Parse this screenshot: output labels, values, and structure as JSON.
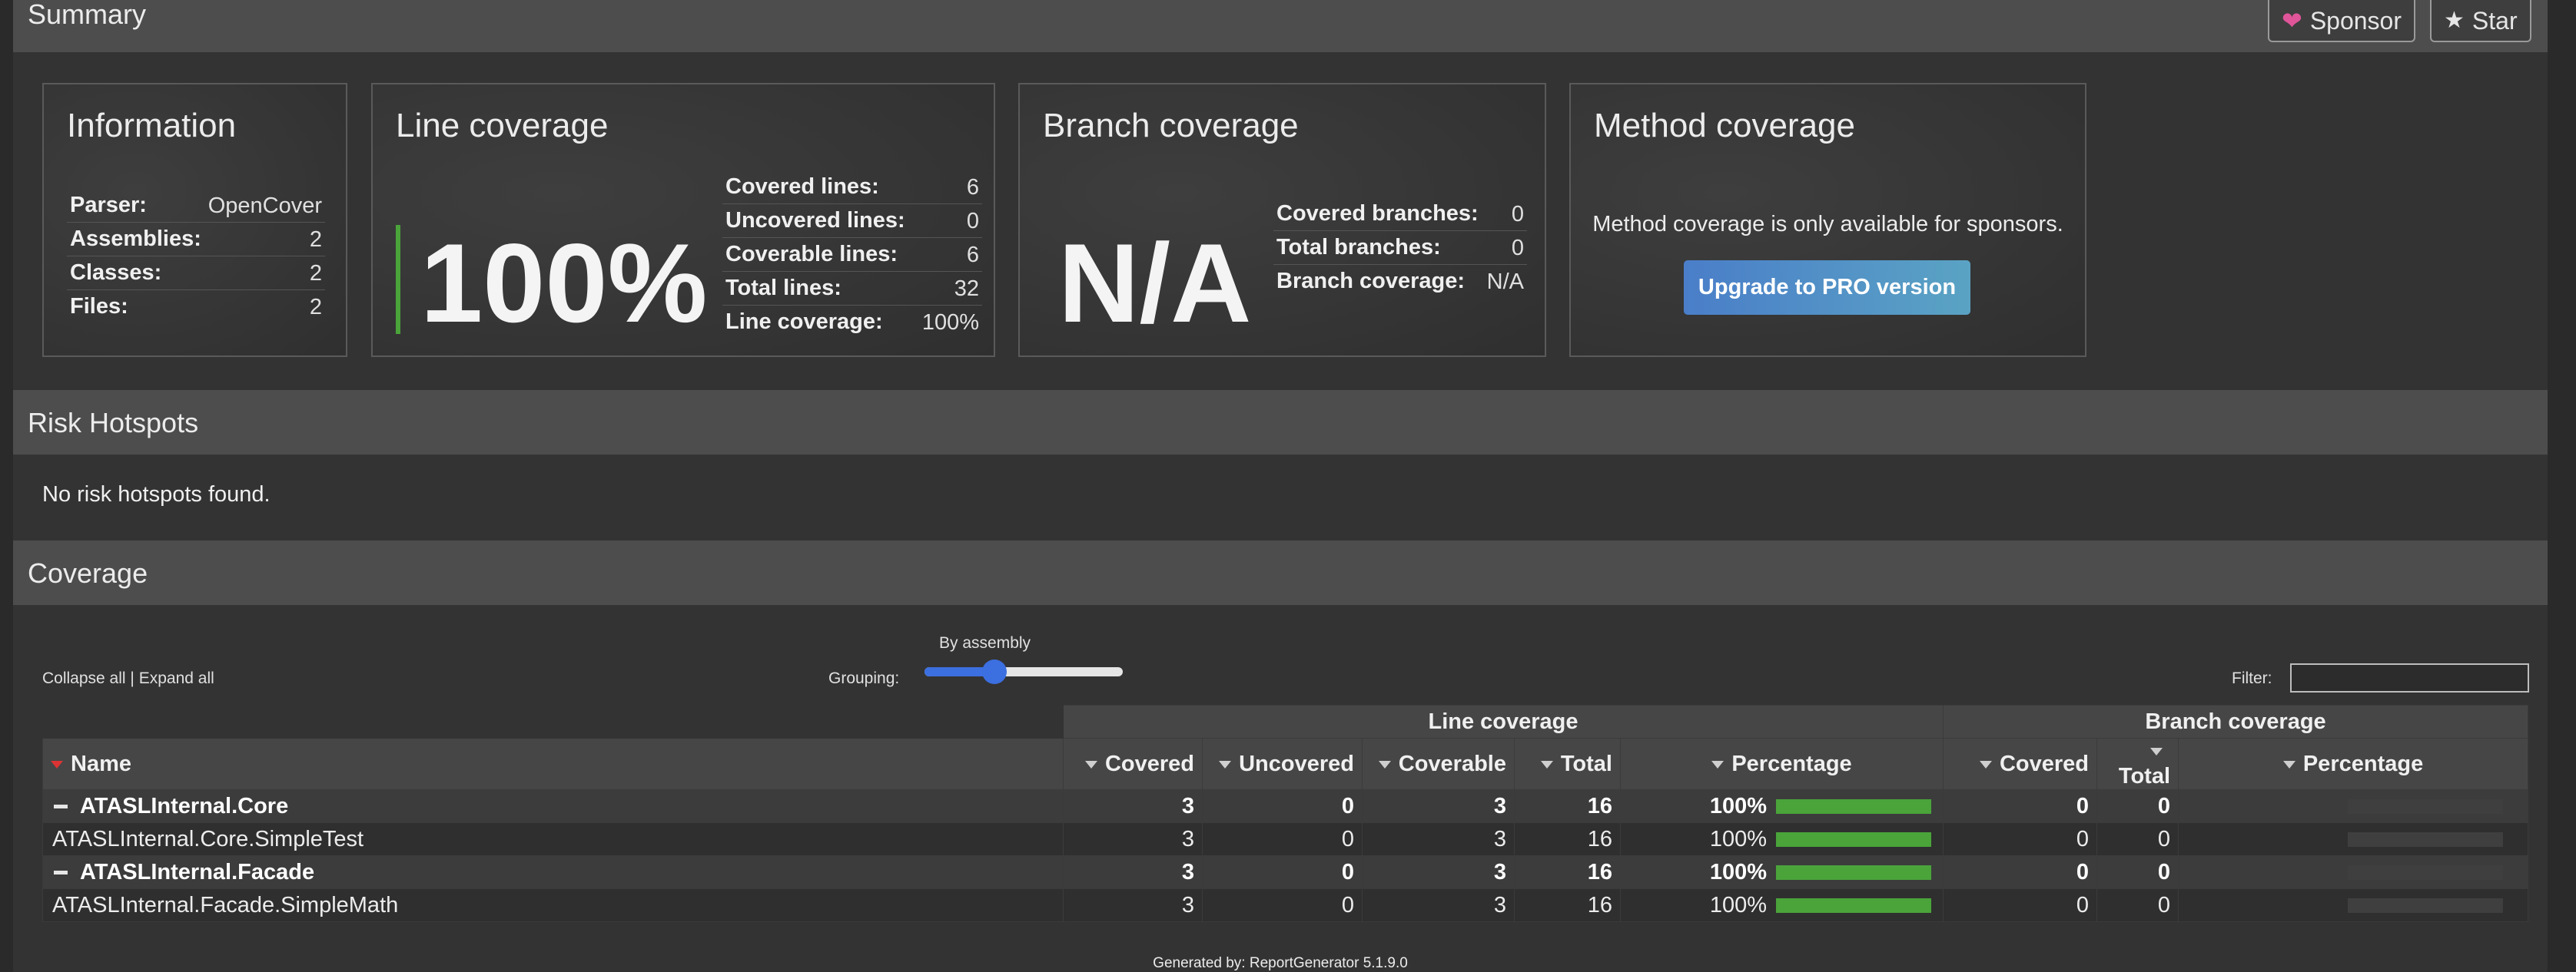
{
  "summary": {
    "title": "Summary",
    "sponsor_label": "Sponsor",
    "star_label": "Star"
  },
  "information": {
    "title": "Information",
    "rows": [
      {
        "label": "Parser:",
        "value": "OpenCover"
      },
      {
        "label": "Assemblies:",
        "value": "2"
      },
      {
        "label": "Classes:",
        "value": "2"
      },
      {
        "label": "Files:",
        "value": "2"
      }
    ]
  },
  "line_coverage": {
    "title": "Line coverage",
    "big_value": "100%",
    "rows": [
      {
        "label": "Covered lines:",
        "value": "6"
      },
      {
        "label": "Uncovered lines:",
        "value": "0"
      },
      {
        "label": "Coverable lines:",
        "value": "6"
      },
      {
        "label": "Total lines:",
        "value": "32"
      },
      {
        "label": "Line coverage:",
        "value": "100%"
      }
    ],
    "accent_color": "#4aa43a"
  },
  "branch_coverage": {
    "title": "Branch coverage",
    "big_value": "N/A",
    "rows": [
      {
        "label": "Covered branches:",
        "value": "0"
      },
      {
        "label": "Total branches:",
        "value": "0"
      },
      {
        "label": "Branch coverage:",
        "value": "N/A"
      }
    ]
  },
  "method_coverage": {
    "title": "Method coverage",
    "message": "Method coverage is only available for sponsors.",
    "button_label": "Upgrade to PRO version"
  },
  "risk": {
    "title": "Risk Hotspots",
    "message": "No risk hotspots found."
  },
  "coverage": {
    "title": "Coverage",
    "collapse_label": "Collapse all",
    "separator": "|",
    "expand_label": "Expand all",
    "grouping_label": "Grouping:",
    "grouping_value": "By assembly",
    "grouping_level": 0.33,
    "filter_label": "Filter:",
    "filter_value": "",
    "group_headers": {
      "line": "Line coverage",
      "branch": "Branch coverage"
    },
    "columns": {
      "name": "Name",
      "covered": "Covered",
      "uncovered": "Uncovered",
      "coverable": "Coverable",
      "total": "Total",
      "percentage": "Percentage",
      "b_covered": "Covered",
      "b_total": "Total",
      "b_percentage": "Percentage"
    },
    "rows": [
      {
        "type": "assembly",
        "name": "ATASLInternal.Core",
        "covered": "3",
        "uncovered": "0",
        "coverable": "3",
        "total": "16",
        "percentage": "100%",
        "line_fill": 1.0,
        "b_covered": "0",
        "b_total": "0",
        "b_percentage": ""
      },
      {
        "type": "class",
        "name": "ATASLInternal.Core.SimpleTest",
        "covered": "3",
        "uncovered": "0",
        "coverable": "3",
        "total": "16",
        "percentage": "100%",
        "line_fill": 1.0,
        "b_covered": "0",
        "b_total": "0",
        "b_percentage": ""
      },
      {
        "type": "assembly",
        "name": "ATASLInternal.Facade",
        "covered": "3",
        "uncovered": "0",
        "coverable": "3",
        "total": "16",
        "percentage": "100%",
        "line_fill": 1.0,
        "b_covered": "0",
        "b_total": "0",
        "b_percentage": ""
      },
      {
        "type": "class",
        "name": "ATASLInternal.Facade.SimpleMath",
        "covered": "3",
        "uncovered": "0",
        "coverable": "3",
        "total": "16",
        "percentage": "100%",
        "line_fill": 1.0,
        "b_covered": "0",
        "b_total": "0",
        "b_percentage": ""
      }
    ]
  },
  "footer": {
    "generated": "Generated by: ReportGenerator 5.1.9.0"
  }
}
